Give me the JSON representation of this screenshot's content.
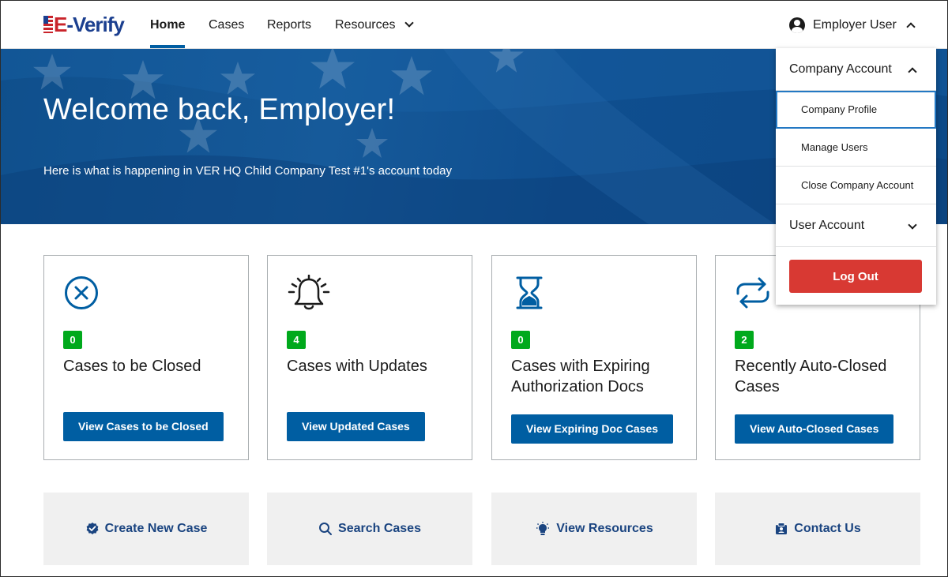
{
  "brand": {
    "logo_text_e": "E",
    "logo_text_rest": "-Verify"
  },
  "nav": {
    "home": "Home",
    "cases": "Cases",
    "reports": "Reports",
    "resources": "Resources"
  },
  "user": {
    "name": "Employer User"
  },
  "hero": {
    "title": "Welcome back, Employer!",
    "subtitle": "Here is what is happening in VER HQ Child Company Test #1's account today"
  },
  "cards": [
    {
      "count": "0",
      "title": "Cases to be Closed",
      "button": "View Cases to be Closed",
      "icon": "x-circle-icon"
    },
    {
      "count": "4",
      "title": "Cases with Updates",
      "button": "View Updated Cases",
      "icon": "bell-icon"
    },
    {
      "count": "0",
      "title": "Cases with Expiring Authorization Docs",
      "button": "View Expiring Doc Cases",
      "icon": "hourglass-icon"
    },
    {
      "count": "2",
      "title": "Recently Auto-Closed Cases",
      "button": "View Auto-Closed Cases",
      "icon": "loop-arrows-icon"
    }
  ],
  "quick_links": [
    {
      "label": "Create New Case",
      "icon": "badge-check-icon"
    },
    {
      "label": "Search Cases",
      "icon": "search-icon"
    },
    {
      "label": "View Resources",
      "icon": "lightbulb-icon"
    },
    {
      "label": "Contact Us",
      "icon": "contact-card-icon"
    }
  ],
  "dropdown": {
    "company_account": "Company Account",
    "company_profile": "Company Profile",
    "manage_users": "Manage Users",
    "close_company_account": "Close Company Account",
    "user_account": "User Account",
    "log_out": "Log Out"
  },
  "colors": {
    "primary": "#005ea2",
    "badge": "#00a91c",
    "danger": "#d83933",
    "link": "#1a4480",
    "hero": "#0f4f8c"
  }
}
